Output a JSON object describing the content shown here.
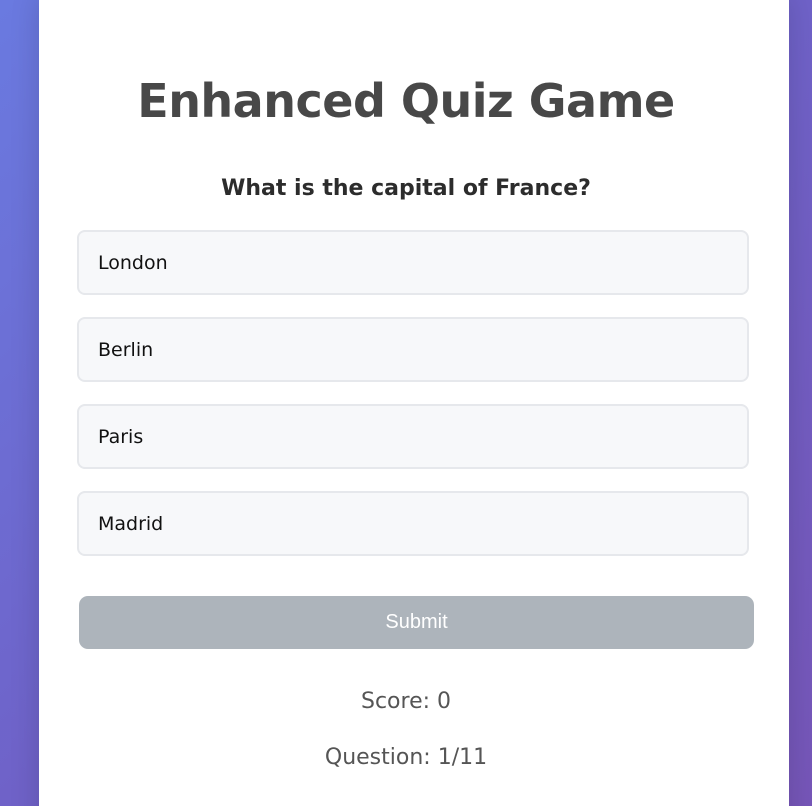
{
  "quiz": {
    "title": "Enhanced Quiz Game",
    "question": "What is the capital of France?",
    "options": [
      "London",
      "Berlin",
      "Paris",
      "Madrid"
    ],
    "submit_label": "Submit",
    "score_text": "Score: 0",
    "progress_text": "Question: 1/11"
  },
  "colors": {
    "background_gradient_start": "#6a7ae0",
    "background_gradient_end": "#7656b8",
    "card": "#ffffff",
    "title_text": "#484848",
    "option_background": "#f7f8fa",
    "option_border": "#e6e8ec",
    "submit_disabled": "#adb4bb"
  }
}
